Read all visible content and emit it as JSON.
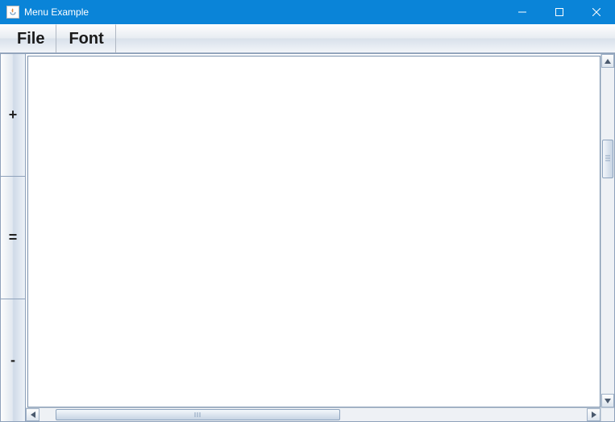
{
  "window": {
    "title": "Menu Example"
  },
  "menubar": {
    "items": [
      "File",
      "Font"
    ]
  },
  "side_toolbar": {
    "buttons": [
      "+",
      "=",
      "-"
    ]
  },
  "text_content": "",
  "scroll": {
    "v_thumb_top_pct": 22,
    "v_thumb_height_pct": 12,
    "h_thumb_left_pct": 3,
    "h_thumb_width_pct": 52
  }
}
